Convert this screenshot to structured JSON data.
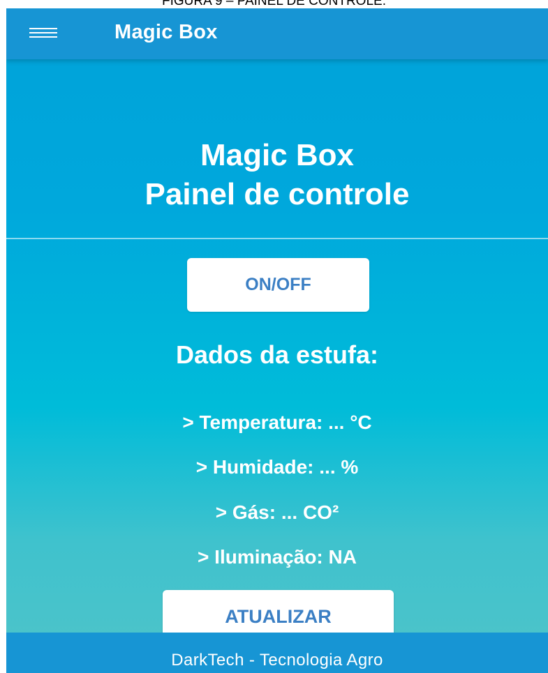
{
  "caption": "FIGURA 9 – PAINEL DE CONTROLE.",
  "appbar": {
    "menu_icon": "hamburger-menu-icon",
    "title": "Magic Box"
  },
  "hero": {
    "title_line1": "Magic Box",
    "title_line2": "Painel de controle"
  },
  "controls": {
    "onoff_label": "ON/OFF",
    "update_label": "ATUALIZAR"
  },
  "section": {
    "title": "Dados da estufa:"
  },
  "readings": {
    "temperature": "> Temperatura: ... °C",
    "humidity": "> Humidade: ... %",
    "gas": "> Gás: ... CO²",
    "lighting": "> Iluminação: NA"
  },
  "footer": {
    "text": "DarkTech - Tecnologia Agro"
  },
  "colors": {
    "appbar": "#1795d4",
    "gradient_top": "#00a2d9",
    "gradient_bottom": "#4fc4c9",
    "button_text": "#3b7fc4"
  }
}
